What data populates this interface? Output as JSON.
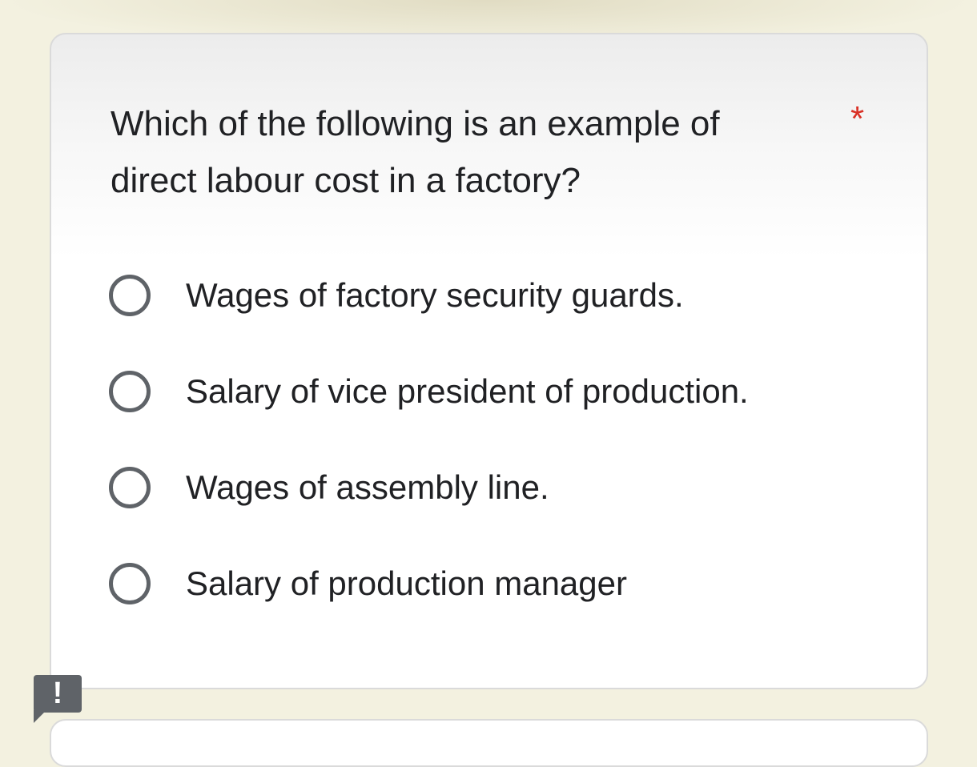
{
  "question": {
    "text": "Which of the following is an example of direct labour cost in a factory?",
    "required_marker": "*",
    "options": [
      {
        "label": "Wages of factory security guards.",
        "selected": false
      },
      {
        "label": "Salary of vice president of production.",
        "selected": false
      },
      {
        "label": "Wages of assembly line.",
        "selected": false
      },
      {
        "label": "Salary of production manager",
        "selected": false
      }
    ]
  },
  "feedback_button": {
    "icon": "report-problem-icon",
    "glyph": "!"
  },
  "colors": {
    "background": "#f3f1e0",
    "required_star": "#d93025",
    "radio_outline": "#5f6368",
    "text": "#202124"
  }
}
